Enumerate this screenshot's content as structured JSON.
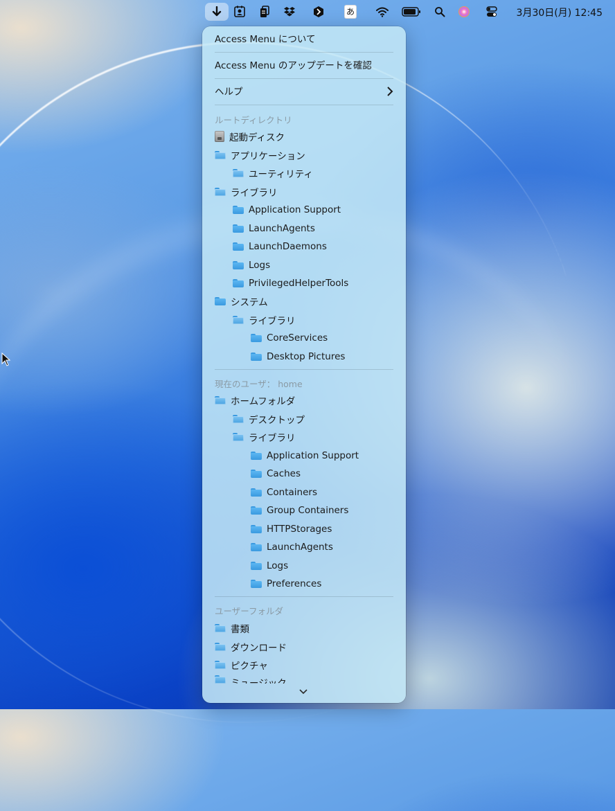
{
  "menubar": {
    "icons": [
      "download-arrow-icon",
      "contacts-icon",
      "clipboard-icon",
      "dropbox-icon",
      "hexagon-app-icon",
      "input-method-icon",
      "wifi-icon",
      "battery-icon",
      "search-icon",
      "siri-icon",
      "control-center-icon"
    ],
    "ime_label": "あ",
    "clock": "3月30日(月)  12:45"
  },
  "menu": {
    "about": "Access Menu について",
    "check_update": "Access Menu のアップデートを確認",
    "help": "ヘルプ",
    "root_header": "ルートディレクトリ",
    "user_header": "現在のユーザ： home",
    "user_folder_header": "ユーザーフォルダ",
    "root_items": [
      {
        "label": "起動ディスク"
      },
      {
        "label": "アプリケーション"
      },
      {
        "label": "ユーティリティ"
      },
      {
        "label": "ライブラリ"
      },
      {
        "label": "Application Support"
      },
      {
        "label": "LaunchAgents"
      },
      {
        "label": "LaunchDaemons"
      },
      {
        "label": "Logs"
      },
      {
        "label": "PrivilegedHelperTools"
      },
      {
        "label": "システム"
      },
      {
        "label": "ライブラリ"
      },
      {
        "label": "CoreServices"
      },
      {
        "label": "Desktop Pictures"
      }
    ],
    "user_items": [
      {
        "label": "ホームフォルダ"
      },
      {
        "label": "デスクトップ"
      },
      {
        "label": "ライブラリ"
      },
      {
        "label": "Application Support"
      },
      {
        "label": "Caches"
      },
      {
        "label": "Containers"
      },
      {
        "label": "Group Containers"
      },
      {
        "label": "HTTPStorages"
      },
      {
        "label": "LaunchAgents"
      },
      {
        "label": "Logs"
      },
      {
        "label": "Preferences"
      }
    ],
    "user_folder_items": [
      {
        "label": "書類"
      },
      {
        "label": "ダウンロード"
      },
      {
        "label": "ピクチャ"
      },
      {
        "label": "ミュージック"
      }
    ]
  }
}
